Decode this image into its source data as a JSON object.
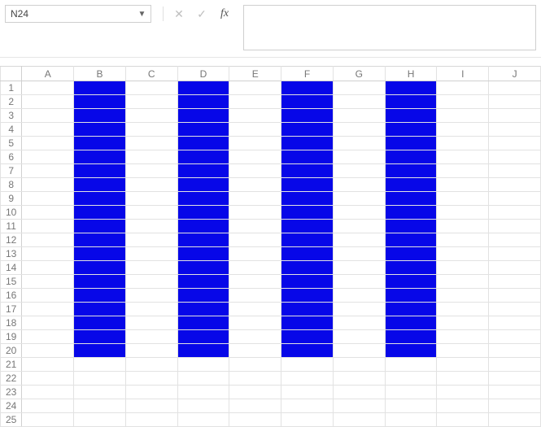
{
  "name_box": {
    "value": "N24"
  },
  "formula_bar": {
    "cancel_tip": "✕",
    "enter_tip": "✓",
    "fx_label": "fx",
    "value": ""
  },
  "columns": [
    "A",
    "B",
    "C",
    "D",
    "E",
    "F",
    "G",
    "H",
    "I",
    "J"
  ],
  "row_count": 25,
  "fill": {
    "color": "#0707e8",
    "cols": [
      "B",
      "D",
      "F",
      "H"
    ],
    "rows_from": 1,
    "rows_to": 20
  }
}
